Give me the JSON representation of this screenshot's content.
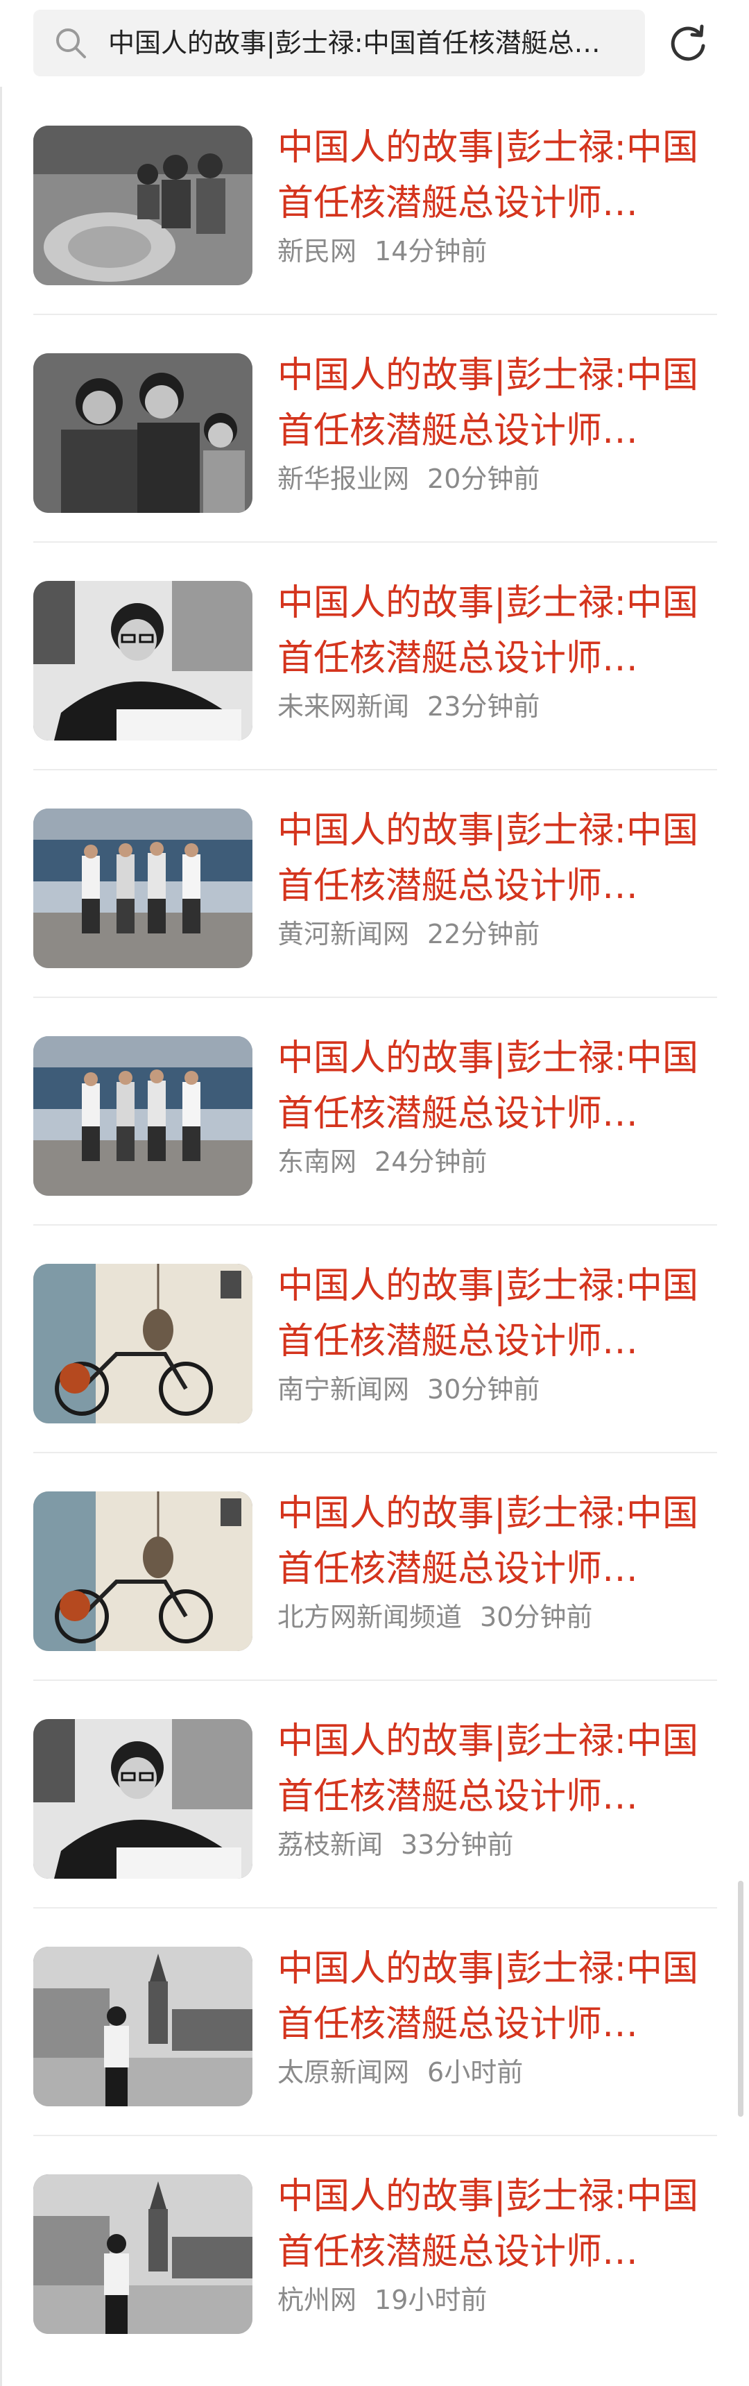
{
  "search": {
    "query": "中国人的故事|彭士禄:中国首任核潜艇总…"
  },
  "icons": {
    "search": "search-icon",
    "refresh": "refresh-icon"
  },
  "colors": {
    "title": "#d4341d",
    "meta": "#8a8a8a",
    "search_bg": "#f2f2f2"
  },
  "articles": [
    {
      "title": "中国人的故事|彭士禄:中国首任核潜艇总设计师…",
      "source": "新民网",
      "time": "14分钟前",
      "thumb": "lab-group-photo"
    },
    {
      "title": "中国人的故事|彭士禄:中国首任核潜艇总设计师…",
      "source": "新华报业网",
      "time": "20分钟前",
      "thumb": "family-portrait"
    },
    {
      "title": "中国人的故事|彭士禄:中国首任核潜艇总设计师…",
      "source": "未来网新闻",
      "time": "23分钟前",
      "thumb": "man-at-desk"
    },
    {
      "title": "中国人的故事|彭士禄:中国首任核潜艇总设计师…",
      "source": "黄河新闻网",
      "time": "22分钟前",
      "thumb": "men-at-dock"
    },
    {
      "title": "中国人的故事|彭士禄:中国首任核潜艇总设计师…",
      "source": "东南网",
      "time": "24分钟前",
      "thumb": "men-at-dock"
    },
    {
      "title": "中国人的故事|彭士禄:中国首任核潜艇总设计师…",
      "source": "南宁新闻网",
      "time": "30分钟前",
      "thumb": "bicycle-room"
    },
    {
      "title": "中国人的故事|彭士禄:中国首任核潜艇总设计师…",
      "source": "北方网新闻频道",
      "time": "30分钟前",
      "thumb": "bicycle-room"
    },
    {
      "title": "中国人的故事|彭士禄:中国首任核潜艇总设计师…",
      "source": "荔枝新闻",
      "time": "33分钟前",
      "thumb": "man-at-desk"
    },
    {
      "title": "中国人的故事|彭士禄:中国首任核潜艇总设计师…",
      "source": "太原新闻网",
      "time": "6小时前",
      "thumb": "man-at-square"
    },
    {
      "title": "中国人的故事|彭士禄:中国首任核潜艇总设计师…",
      "source": "杭州网",
      "time": "19小时前",
      "thumb": "man-at-square"
    }
  ]
}
